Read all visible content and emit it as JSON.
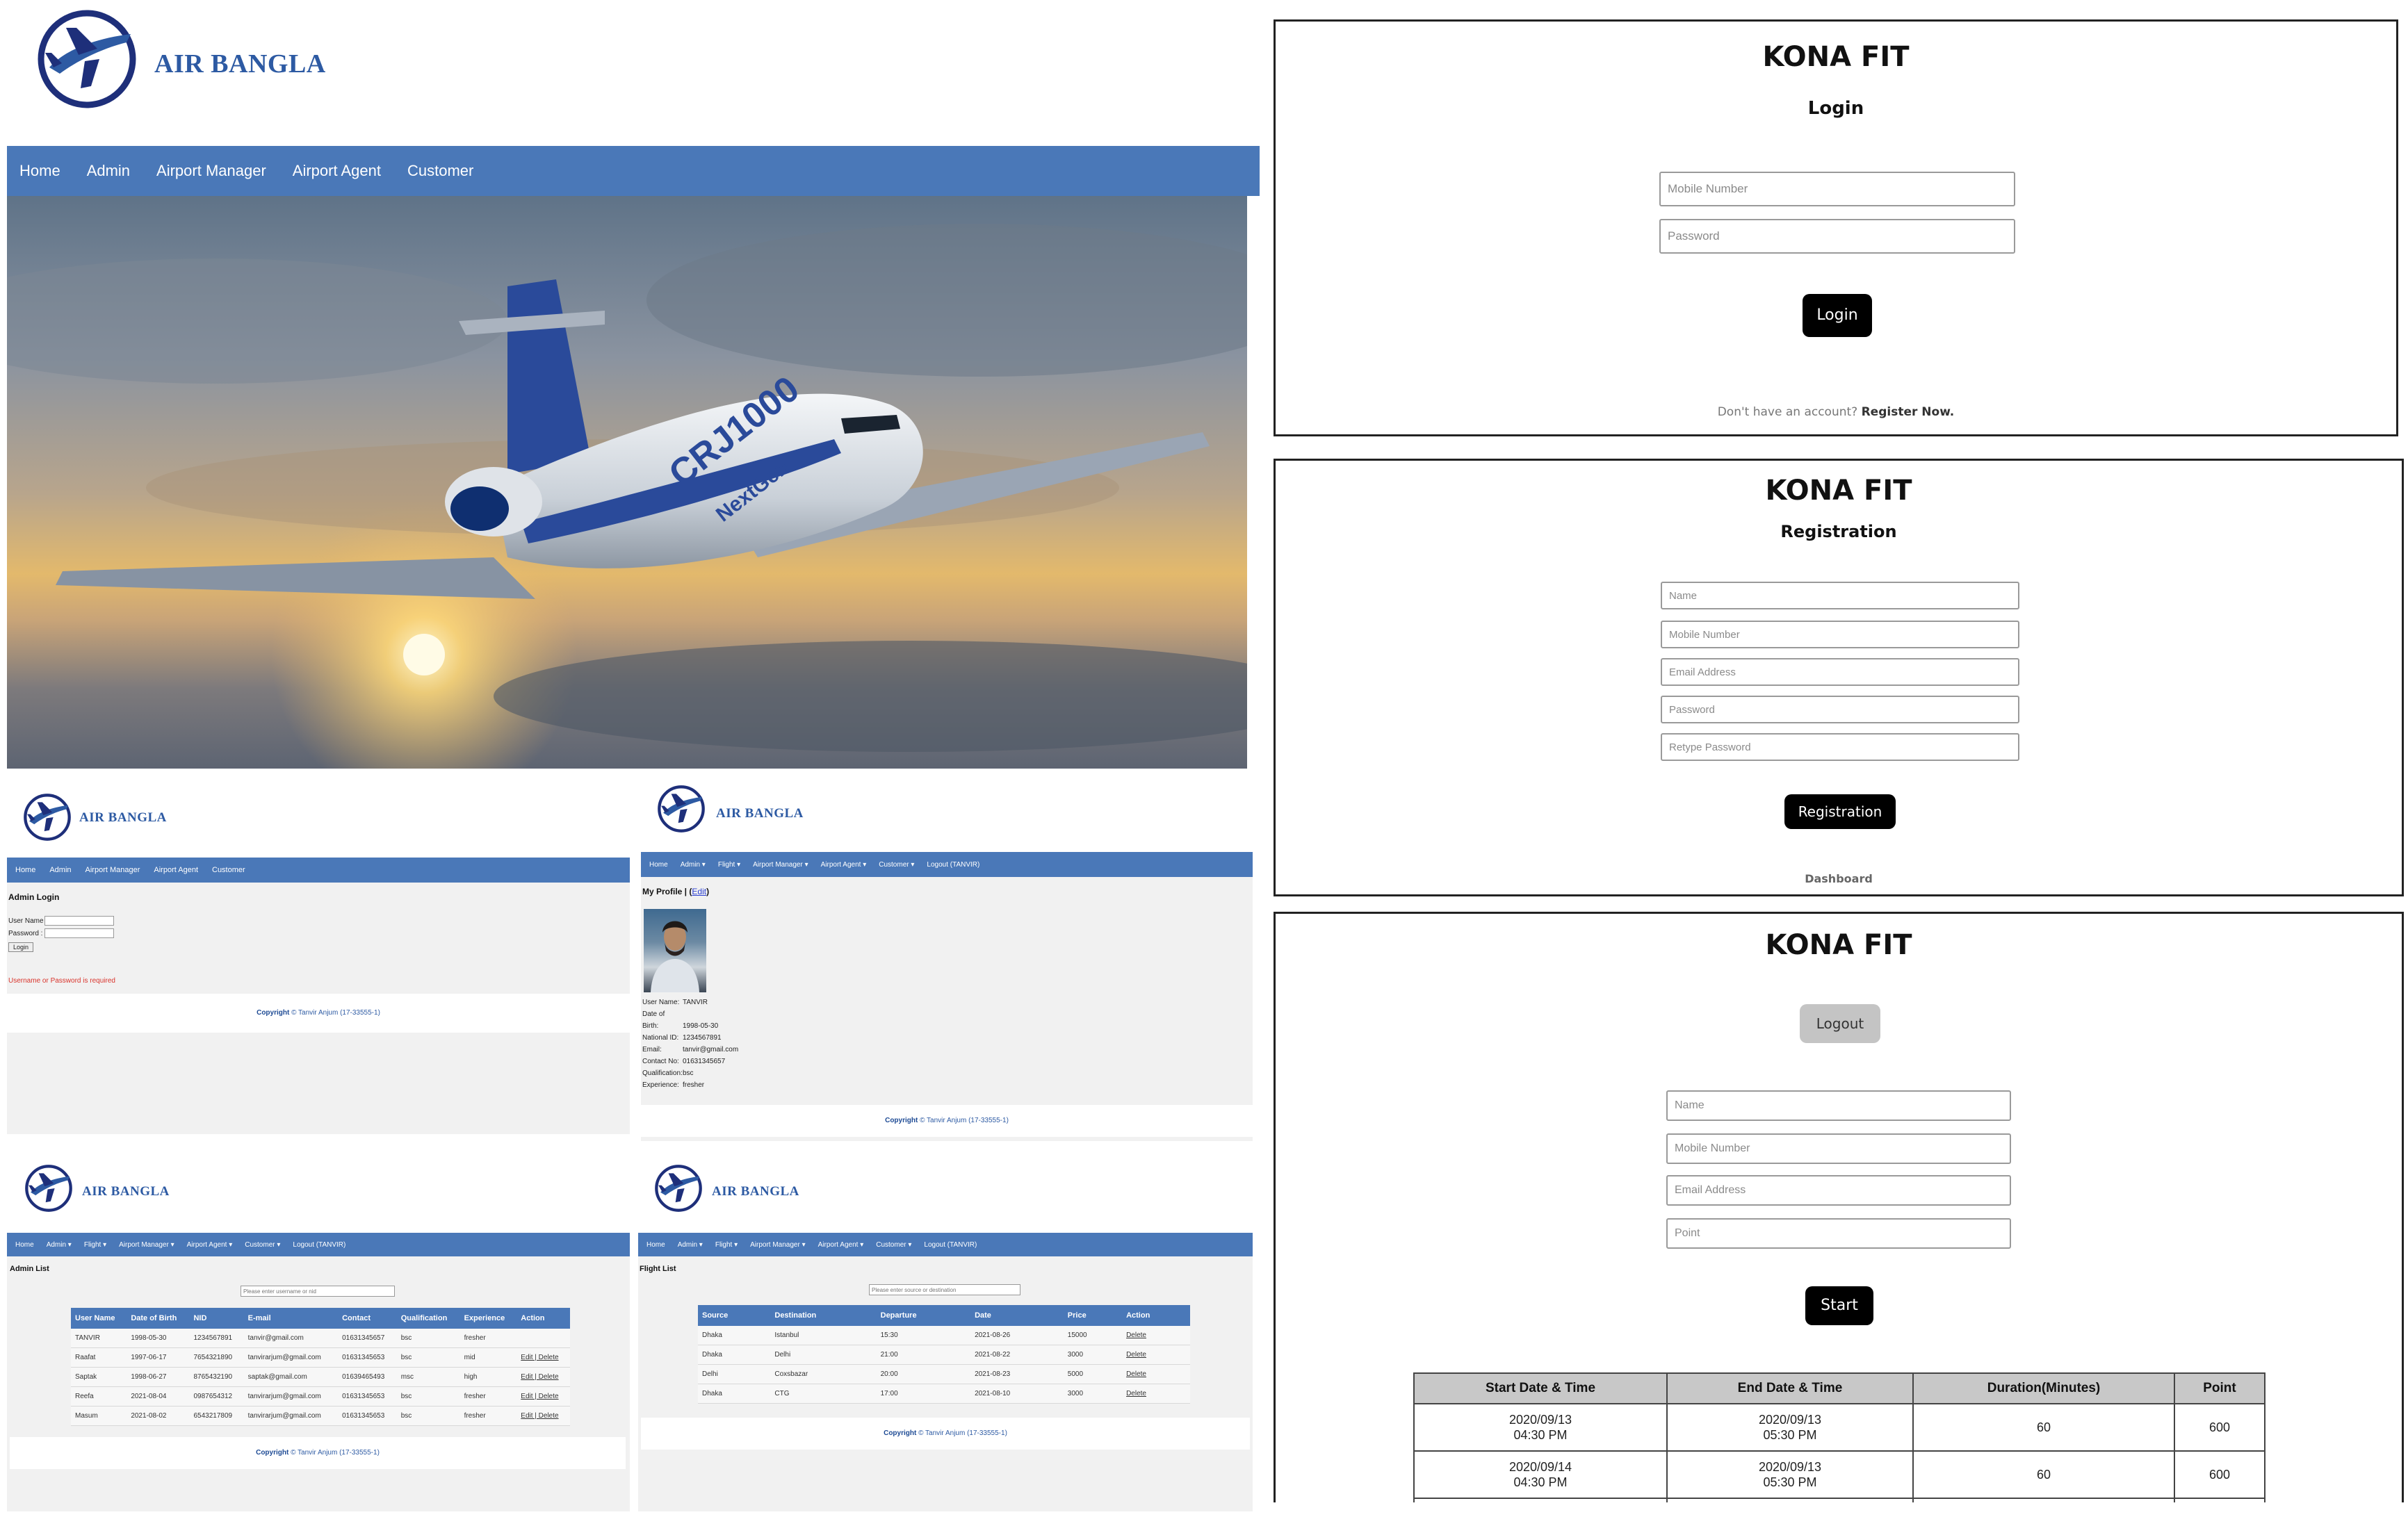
{
  "brand": {
    "air": "AIR BANGLA",
    "kona": "KONA FIT"
  },
  "hero": {
    "nav": [
      "Home",
      "Admin",
      "Airport Manager",
      "Airport Agent",
      "Customer"
    ],
    "plane_livery": "CRJ1000",
    "plane_sub": "NextGen"
  },
  "admin_login": {
    "nav": [
      "Home",
      "Admin",
      "Airport Manager",
      "Airport Agent",
      "Customer"
    ],
    "heading": "Admin Login",
    "username_label": "User Name :",
    "password_label": "Password :",
    "login_button": "Login",
    "error": "Username or Password is required",
    "copyright_word": "Copyright",
    "copyright_rest": "© Tanvir Anjum (17-33555-1)"
  },
  "profile": {
    "nav": [
      "Home",
      "Admin ▾",
      "Flight ▾",
      "Airport Manager ▾",
      "Airport Agent ▾",
      "Customer ▾",
      "Logout (TANVIR)"
    ],
    "heading": "My Profile |",
    "edit": "Edit",
    "fields": [
      {
        "k": "User Name:",
        "v": "TANVIR"
      },
      {
        "k": "Date of Birth:",
        "v": "1998-05-30"
      },
      {
        "k": "National ID:",
        "v": "1234567891"
      },
      {
        "k": "Email:",
        "v": "tanvir@gmail.com"
      },
      {
        "k": "Contact No:",
        "v": "01631345657"
      },
      {
        "k": "Qualification:",
        "v": "bsc"
      },
      {
        "k": "Experience:",
        "v": "fresher"
      }
    ],
    "copyright_word": "Copyright",
    "copyright_rest": "© Tanvir Anjum (17-33555-1)"
  },
  "admin_list": {
    "nav": [
      "Home",
      "Admin ▾",
      "Flight ▾",
      "Airport Manager ▾",
      "Airport Agent ▾",
      "Customer ▾",
      "Logout (TANVIR)"
    ],
    "heading": "Admin List",
    "search_placeholder": "Please enter username or nid",
    "columns": [
      "User Name",
      "Date of Birth",
      "NID",
      "E-mail",
      "Contact",
      "Qualification",
      "Experience",
      "Action"
    ],
    "rows": [
      [
        "TANVIR",
        "1998-05-30",
        "1234567891",
        "tanvir@gmail.com",
        "01631345657",
        "bsc",
        "fresher",
        ""
      ],
      [
        "Raafat",
        "1997-06-17",
        "7654321890",
        "tanvirarjum@gmail.com",
        "01631345653",
        "bsc",
        "mid",
        "Edit | Delete"
      ],
      [
        "Saptak",
        "1998-06-27",
        "8765432190",
        "saptak@gmail.com",
        "01639465493",
        "msc",
        "high",
        "Edit | Delete"
      ],
      [
        "Reefa",
        "2021-08-04",
        "0987654312",
        "tanvirarjum@gmail.com",
        "01631345653",
        "bsc",
        "fresher",
        "Edit | Delete"
      ],
      [
        "Masum",
        "2021-08-02",
        "6543217809",
        "tanvirarjum@gmail.com",
        "01631345653",
        "bsc",
        "fresher",
        "Edit | Delete"
      ]
    ],
    "copyright_word": "Copyright",
    "copyright_rest": "© Tanvir Anjum (17-33555-1)"
  },
  "flight_list": {
    "nav": [
      "Home",
      "Admin ▾",
      "Flight ▾",
      "Airport Manager ▾",
      "Airport Agent ▾",
      "Customer ▾",
      "Logout (TANVIR)"
    ],
    "heading": "Flight List",
    "search_placeholder": "Please enter source or destination",
    "columns": [
      "Source",
      "Destination",
      "Departure",
      "Date",
      "Price",
      "Action"
    ],
    "rows": [
      [
        "Dhaka",
        "Istanbul",
        "15:30",
        "2021-08-26",
        "15000",
        "Delete"
      ],
      [
        "Dhaka",
        "Delhi",
        "21:00",
        "2021-08-22",
        "3000",
        "Delete"
      ],
      [
        "Delhi",
        "Coxsbazar",
        "20:00",
        "2021-08-23",
        "5000",
        "Delete"
      ],
      [
        "Dhaka",
        "CTG",
        "17:00",
        "2021-08-10",
        "3000",
        "Delete"
      ]
    ],
    "copyright_word": "Copyright",
    "copyright_rest": "© Tanvir Anjum (17-33555-1)"
  },
  "kona_login": {
    "title": "Login",
    "mobile_placeholder": "Mobile Number",
    "password_placeholder": "Password",
    "button": "Login",
    "no_account": "Don't have an account?",
    "register": "Register Now."
  },
  "kona_register": {
    "title": "Registration",
    "name_placeholder": "Name",
    "mobile_placeholder": "Mobile Number",
    "email_placeholder": "Email Address",
    "password_placeholder": "Password",
    "retype_placeholder": "Retype Password",
    "button": "Registration",
    "dashboard": "Dashboard"
  },
  "kona_dashboard": {
    "logout": "Logout",
    "name_placeholder": "Name",
    "mobile_placeholder": "Mobile Number",
    "email_placeholder": "Email Address",
    "point_placeholder": "Point",
    "start": "Start",
    "columns": [
      "Start Date & Time",
      "End Date & Time",
      "Duration(Minutes)",
      "Point"
    ],
    "rows": [
      {
        "start_date": "2020/09/13",
        "start_time": "04:30 PM",
        "end_date": "2020/09/13",
        "end_time": "05:30 PM",
        "duration": "60",
        "point": "600"
      },
      {
        "start_date": "2020/09/14",
        "start_time": "04:30 PM",
        "end_date": "2020/09/13",
        "end_time": "05:30 PM",
        "duration": "60",
        "point": "600"
      }
    ]
  },
  "colors": {
    "nav_blue": "#4a78b8",
    "brand_blue": "#2d5aa3",
    "black_button": "#000000"
  }
}
